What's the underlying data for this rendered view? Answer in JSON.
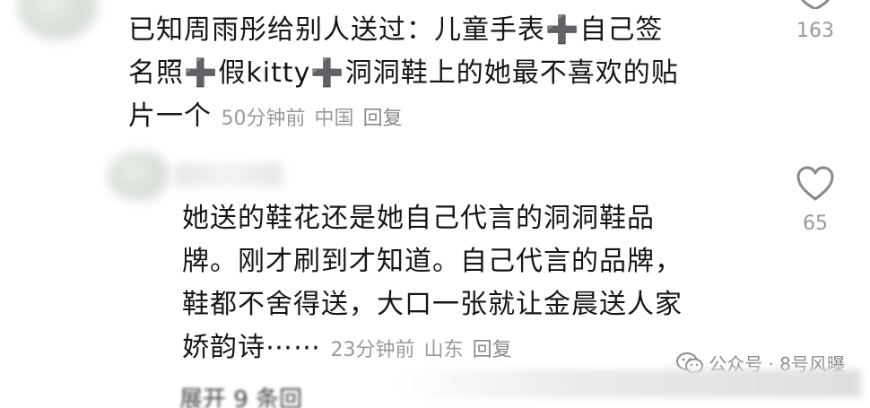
{
  "comment1": {
    "line1": "已知周雨彤给别人送过：儿童手表",
    "line1b": "自己签",
    "line2a": "名照",
    "line2b": "假kitty",
    "line2c": "洞洞鞋上的她最不喜欢的贴",
    "line3": "片一个",
    "plus_symbol": "➕",
    "time": "50分钟前",
    "location": "中国",
    "reply": "回复",
    "likes": "163"
  },
  "comment2": {
    "line1": "她送的鞋花还是她自己代言的洞洞鞋品",
    "line2": "牌。刚才刷到才知道。自己代言的品牌，",
    "line3": "鞋都不舍得送，大口一张就让金晨送人家",
    "line4": "娇韵诗⋯⋯",
    "time": "23分钟前",
    "location": "山东",
    "reply": "回复",
    "likes": "65"
  },
  "watermark": {
    "text": "公众号 · 8号风曝"
  },
  "footer": {
    "partial": "展开 9 条回"
  }
}
